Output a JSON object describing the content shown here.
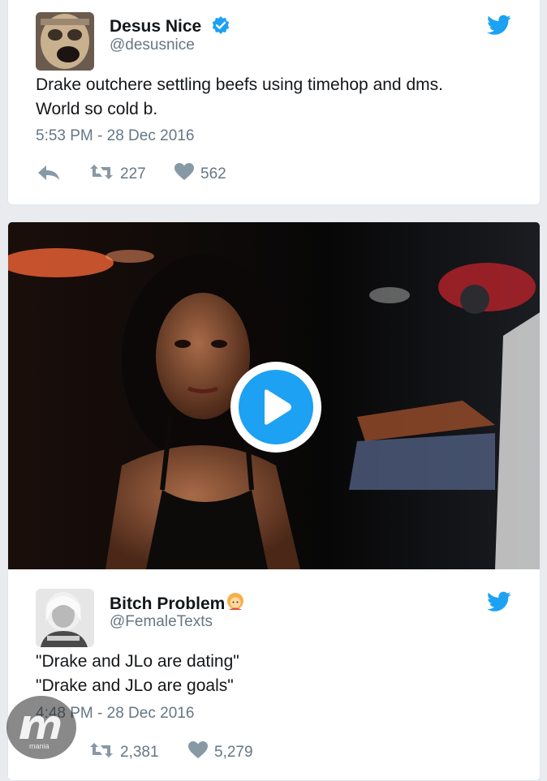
{
  "tweet1": {
    "name": "Desus Nice",
    "handle": "@desusnice",
    "text_line1": "Drake outchere settling beefs using timehop and dms.",
    "text_line2": "World so cold b.",
    "timestamp": "5:53 PM - 28 Dec 2016",
    "retweets": "227",
    "likes": "562",
    "verified": true
  },
  "video": {
    "icon": "play-icon"
  },
  "tweet2": {
    "name": "Bitch Problem",
    "handle": "@FemaleTexts",
    "text_line1": "\"Drake and JLo are dating\"",
    "text_line2": "\"Drake and JLo are goals\"",
    "timestamp": "4:48 PM - 28 Dec 2016",
    "retweets": "2,381",
    "likes": "5,279"
  },
  "watermark": {
    "label": "mp"
  },
  "colors": {
    "twitter_blue": "#1da1f2",
    "secondary_text": "#657786",
    "icon_gray": "#8899a6",
    "background": "#e9ebee"
  }
}
